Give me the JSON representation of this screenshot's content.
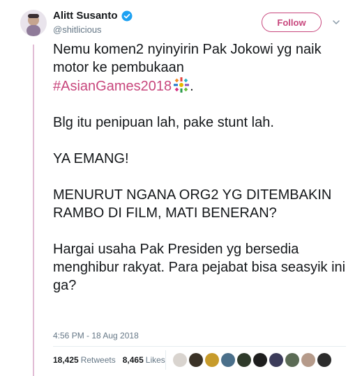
{
  "user": {
    "display_name": "Alitt Susanto",
    "handle": "@shitlicious",
    "verified": true
  },
  "follow_label": "Follow",
  "tweet": {
    "line1_prefix": "Nemu komen2 nyinyirin Pak Jokowi yg naik motor ke pembukaan",
    "hashtag": "#AsianGames2018",
    "line1_suffix": ".",
    "para2": "Blg itu penipuan lah, pake stunt lah.",
    "para3": "YA EMANG!",
    "para4": "MENURUT NGANA ORG2 YG DITEMBAKIN RAMBO DI FILM, MATI BENERAN?",
    "para5": "Hargai usaha Pak Presiden yg bersedia menghibur rakyat. Para pejabat bisa seasyik ini ga?"
  },
  "timestamp": "4:56 PM - 18 Aug 2018",
  "stats": {
    "retweets_count": "18,425",
    "retweets_label": "Retweets",
    "likes_count": "8,465",
    "likes_label": "Likes"
  },
  "colors": {
    "accent": "#c8477d",
    "thread_line": "#e1bcd5",
    "muted": "#657786"
  },
  "liker_avatar_colors": [
    "#d9d4cf",
    "#3a3226",
    "#c79b2b",
    "#4a6f8a",
    "#2f3a2a",
    "#1e1e1e",
    "#3b3b5a",
    "#5b6b55",
    "#b59a8a",
    "#2c2c2c"
  ]
}
